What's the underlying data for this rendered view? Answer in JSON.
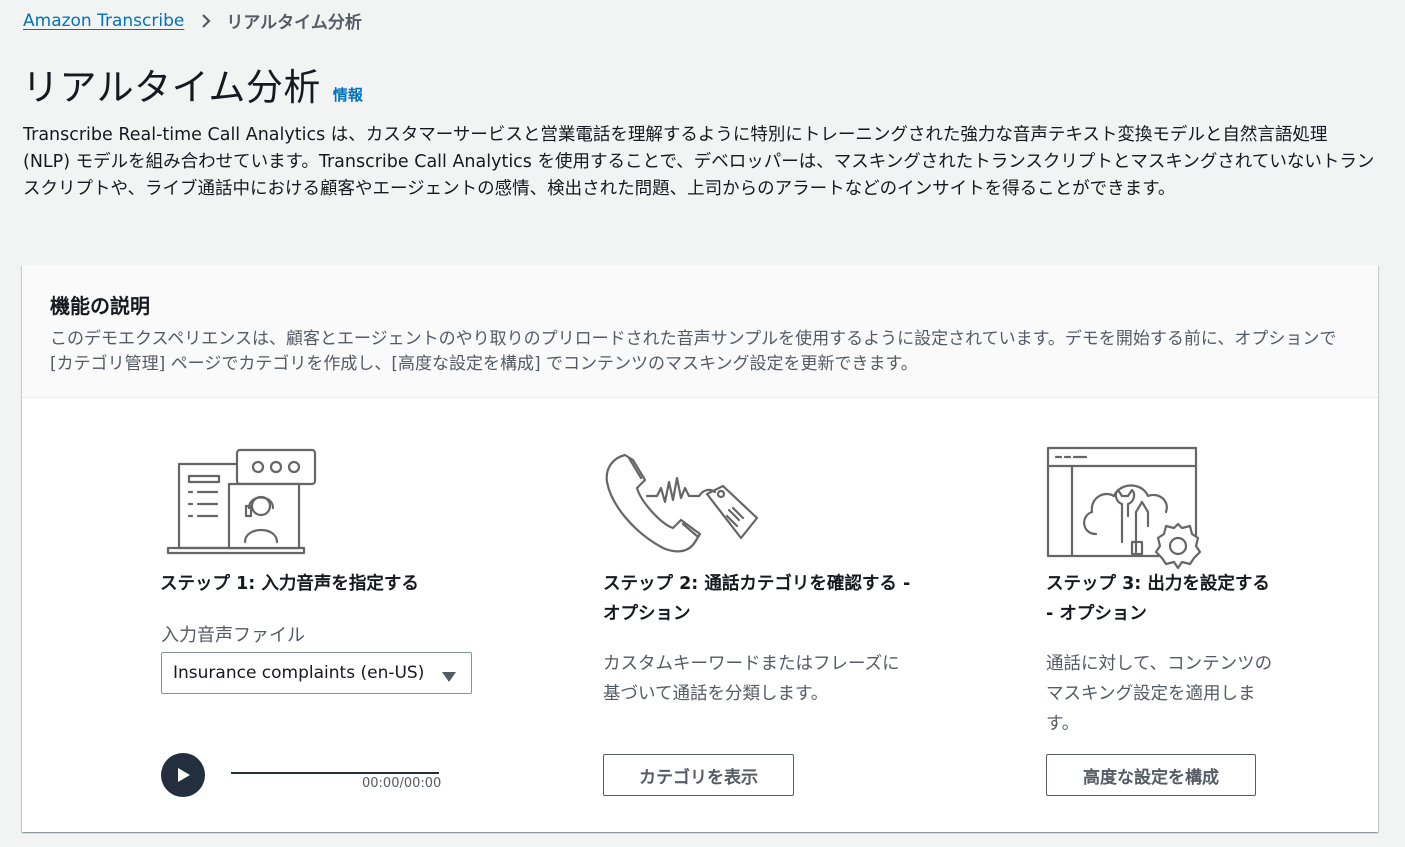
{
  "breadcrumb": {
    "root": "Amazon Transcribe",
    "separator_icon": "chevron-right-icon",
    "current": "リアルタイム分析"
  },
  "header": {
    "title": "リアルタイム分析",
    "info_label": "情報"
  },
  "intro": {
    "text": "Transcribe Real-time Call Analytics は、カスタマーサービスと営業電話を理解するように特別にトレーニングされた強力な音声テキスト変換モデルと自然言語処理 (NLP) モデルを組み合わせています。Transcribe Call Analytics を使用することで、デベロッパーは、マスキングされたトランスクリプトとマスキングされていないトランスクリプトや、ライブ通話中における顧客やエージェントの感情、検出された問題、上司からのアラートなどのインサイトを得ることができます。"
  },
  "panel": {
    "title": "機能の説明",
    "description": "このデモエクスペリエンスは、顧客とエージェントのやり取りのプリロードされた音声サンプルを使用するように設定されています。デモを開始する前に、オプションで [カテゴリ管理] ページでカテゴリを作成し、[高度な設定を構成] でコンテンツのマスキング設定を更新できます。"
  },
  "steps": [
    {
      "icon": "agent-chat-icon",
      "title": "ステップ 1: 入力音声を指定する",
      "field_label": "入力音声ファイル",
      "select_value": "Insurance complaints (en-US)",
      "player": {
        "play_icon": "play-icon",
        "time": "00:00/00:00",
        "progress": 0
      }
    },
    {
      "icon": "phone-tag-icon",
      "title": "ステップ 2: 通話カテゴリを確認する - オプション",
      "description": "カスタムキーワードまたはフレーズに基づいて通話を分類します。",
      "button_label": "カテゴリを表示"
    },
    {
      "icon": "cloud-settings-icon",
      "title": "ステップ 3: 出力を設定する - オプション",
      "description": "通話に対して、コンテンツのマスキング設定を適用します。",
      "button_label": "高度な設定を構成"
    }
  ],
  "colors": {
    "page_bg": "#f2f3f3",
    "link": "#0073bb",
    "text": "#16191f",
    "muted": "#545b64",
    "player_dark": "#232f3e",
    "icon_stroke": "#666666"
  }
}
